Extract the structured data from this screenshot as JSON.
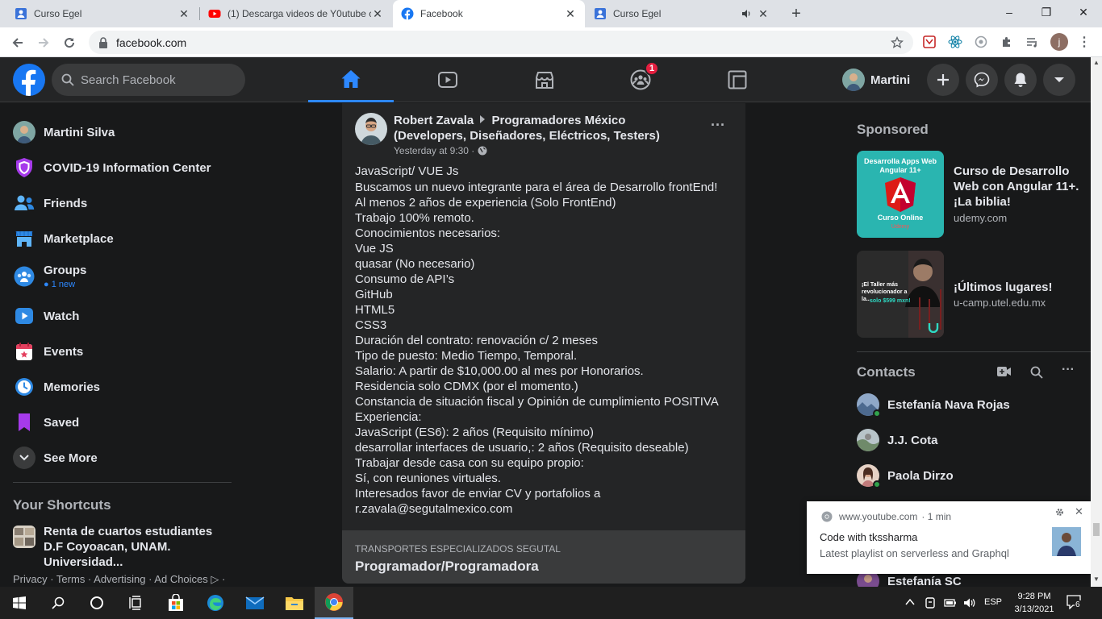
{
  "browser": {
    "tabs": [
      {
        "title": "Curso Egel",
        "icon": "udemy-square-icon",
        "active": false
      },
      {
        "title": "(1) Descarga videos de Y0utube c",
        "icon": "youtube-icon",
        "active": false
      },
      {
        "title": "Facebook",
        "icon": "facebook-icon",
        "active": true
      },
      {
        "title": "Curso Egel",
        "icon": "udemy-square-icon",
        "active": false,
        "audio": true
      }
    ],
    "new_tab": "+",
    "window": {
      "minimize": "–",
      "maximize": "❐",
      "close": "✕"
    },
    "url": "facebook.com",
    "profile_initial": "j"
  },
  "fb": {
    "search_placeholder": "Search Facebook",
    "groups_badge": "1",
    "profile_name": "Martini",
    "sidebar": {
      "items": [
        {
          "label": "Martini Silva"
        },
        {
          "label": "COVID-19 Information Center"
        },
        {
          "label": "Friends"
        },
        {
          "label": "Marketplace"
        },
        {
          "label": "Groups",
          "sub": "1 new"
        },
        {
          "label": "Watch"
        },
        {
          "label": "Events"
        },
        {
          "label": "Memories"
        },
        {
          "label": "Saved"
        },
        {
          "label": "See More"
        }
      ],
      "shortcuts_title": "Your Shortcuts",
      "shortcut": "Renta de cuartos estudiantes D.F Coyoacan, UNAM. Universidad...",
      "footer": "Privacy · Terms · Advertising · Ad Choices ▷ ·"
    },
    "post": {
      "author": "Robert Zavala",
      "group": "Programadores México (Developers, Diseñadores, Eléctricos, Testers)",
      "time": "Yesterday at 9:30 ·",
      "more": "···",
      "title_line": "JavaScript/ VUE Js",
      "lines": [
        "Buscamos un nuevo integrante para el área de Desarrollo frontEnd!",
        "Al menos 2 años de experiencia (Solo FrontEnd)",
        "Trabajo 100% remoto.",
        "Conocimientos necesarios:",
        "Vue JS",
        "quasar (No necesario)",
        "Consumo de API’s",
        "GitHub",
        "HTML5",
        "CSS3",
        "Duración del contrato: renovación c/ 2 meses",
        "Tipo de puesto: Medio Tiempo, Temporal.",
        "Salario: A partir de $10,000.00 al mes por Honorarios.",
        "Residencia solo CDMX (por el momento.)",
        "Constancia de situación fiscal y Opinión de cumplimiento POSITIVA",
        "Experiencia:",
        "JavaScript (ES6): 2 años (Requisito mínimo)",
        "desarrollar interfaces de usuario,: 2 años (Requisito deseable)",
        "Trabajar desde casa con su equipo propio:",
        "Sí, con reuniones virtuales.",
        "Interesados favor de enviar CV y portafolios a",
        "r.zavala@segutalmexico.com"
      ],
      "link_source": "TRANSPORTES ESPECIALIZADOS SEGUTAL",
      "link_title": "Programador/Programadora"
    },
    "sponsored": {
      "title": "Sponsored",
      "ads": [
        {
          "headline": "Curso de Desarrollo Web con Angular 11+. ¡La biblia!",
          "domain": "udemy.com",
          "img_top": "Desarrolla Apps Web Angular 11+",
          "img_bottom": "Curso Online",
          "img_brand": "Udemy"
        },
        {
          "headline": "¡Últimos lugares!",
          "domain": "u-camp.utel.edu.mx",
          "img_text": "¡El Taller más revolucionador a la...",
          "img_price": "solo $599 mxn!"
        }
      ]
    },
    "contacts": {
      "title": "Contacts",
      "list": [
        {
          "name": "Estefanía Nava Rojas",
          "online": true
        },
        {
          "name": "J.J. Cota",
          "online": false
        },
        {
          "name": "Paola Dirzo",
          "online": true
        },
        {
          "name": "Estefanía SC",
          "online": false
        }
      ]
    }
  },
  "notification": {
    "source": "www.youtube.com",
    "time": "· 1 min",
    "title": "Code with tkssharma",
    "body": "Latest playlist on serverless and Graphql"
  },
  "taskbar": {
    "lang": "ESP",
    "time": "9:28 PM",
    "date": "3/13/2021",
    "notifications": "6"
  },
  "colors": {
    "fb_blue": "#1877f2",
    "fb_bg": "#18191a",
    "fb_surface": "#242526",
    "badge_red": "#e41e3f",
    "online_green": "#31a24c"
  }
}
